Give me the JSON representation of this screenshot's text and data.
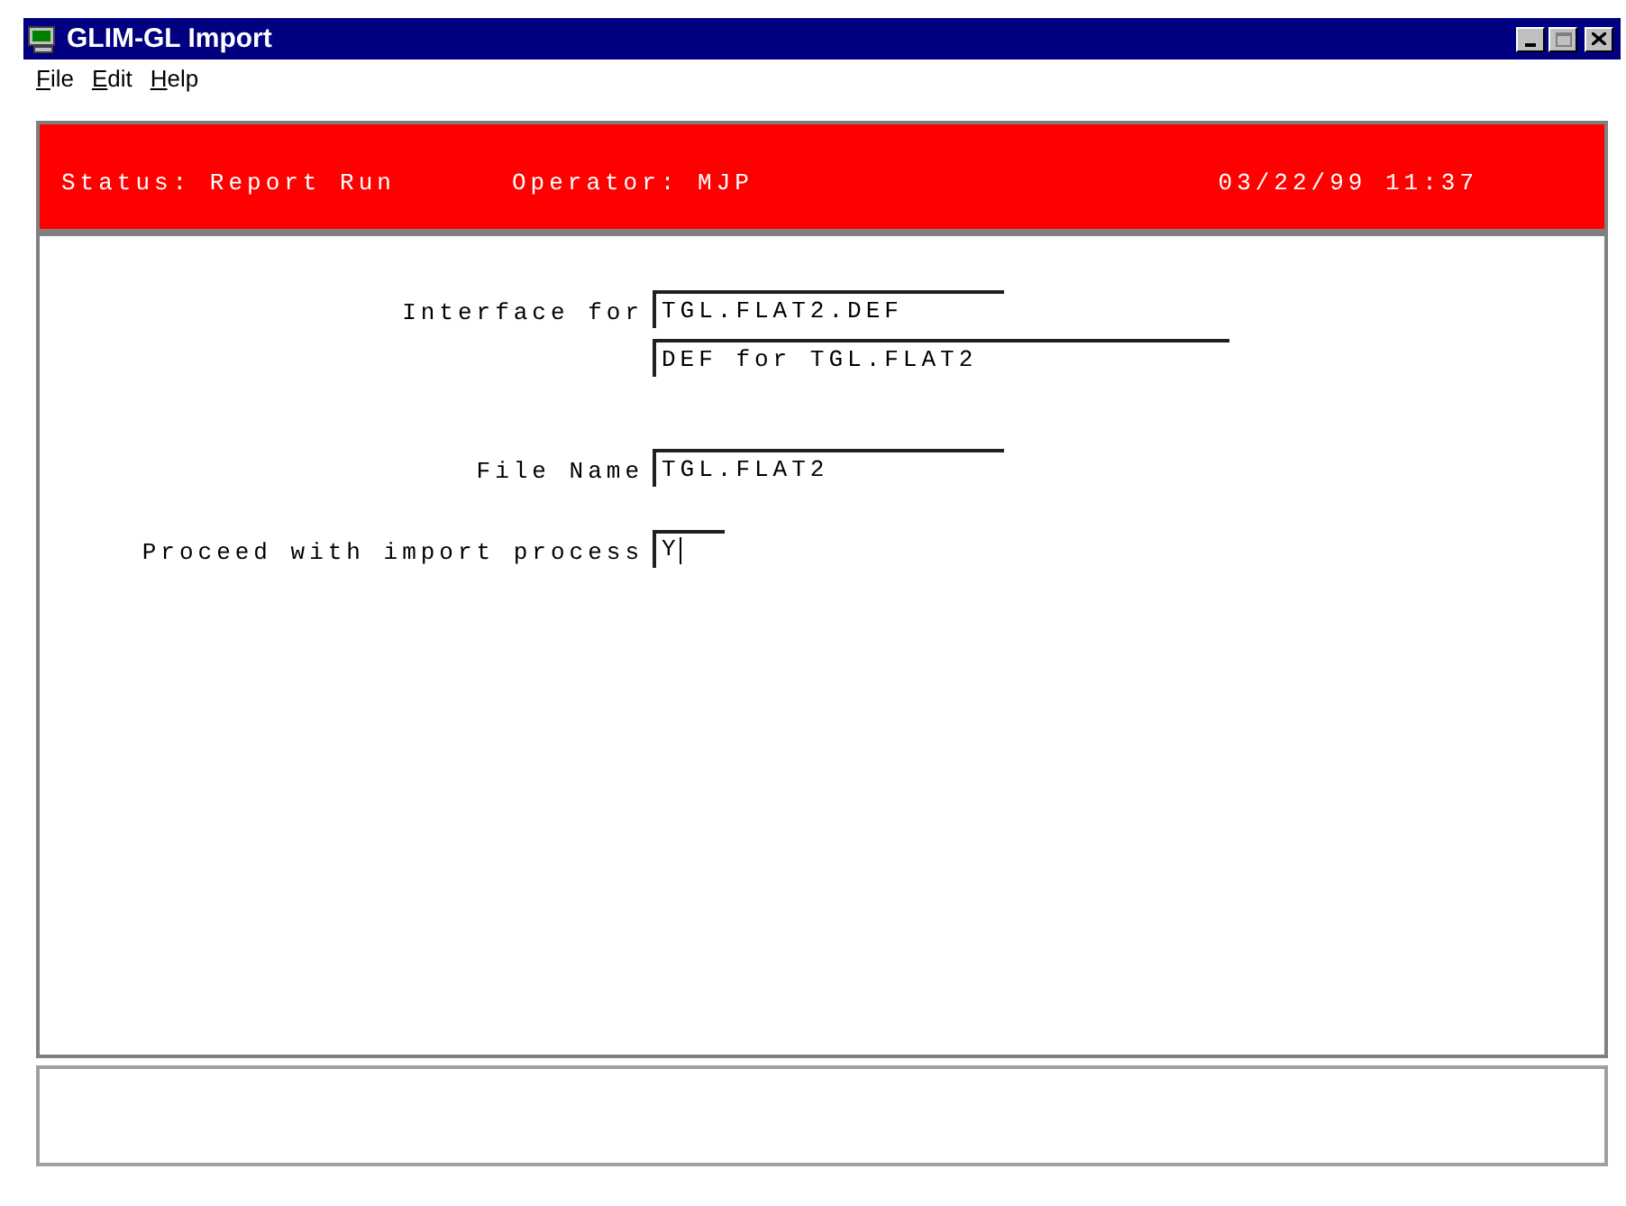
{
  "window": {
    "title": "GLIM-GL Import"
  },
  "menu": [
    {
      "label": "File"
    },
    {
      "label": "Edit"
    },
    {
      "label": "Help"
    }
  ],
  "status_panel": {
    "status": "Status: Report Run",
    "operator": "Operator: MJP",
    "datetime": "03/22/99 11:37"
  },
  "form": [
    {
      "label": "Interface for",
      "fields": [
        {
          "value": "TGL.FLAT2.DEF",
          "kind": "medium",
          "focused": false
        },
        {
          "value": "DEF for TGL.FLAT2",
          "kind": "long",
          "focused": false
        }
      ]
    },
    {
      "label": "File Name",
      "fields": [
        {
          "value": "TGL.FLAT2",
          "kind": "medium",
          "focused": false
        }
      ]
    },
    {
      "label": "Proceed with import process",
      "fields": [
        {
          "value": "Y",
          "kind": "short",
          "focused": true
        }
      ]
    }
  ]
}
